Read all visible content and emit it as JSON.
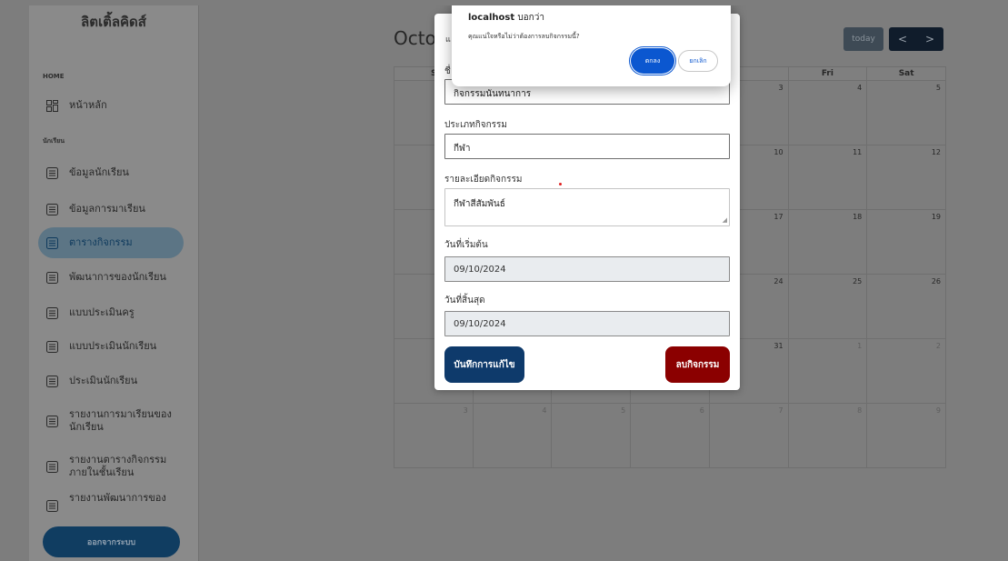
{
  "sidebar": {
    "brand": "ลิตเติ้ลคิดส์",
    "section_home": "HOME",
    "section_students": "นักเรียน",
    "home_item": "หน้าหลัก",
    "items": [
      {
        "label": "ข้อมูลนักเรียน"
      },
      {
        "label": "ข้อมูลการมาเรียน"
      },
      {
        "label": "ตารางกิจกรรม"
      },
      {
        "label": "พัฒนาการของนักเรียน"
      },
      {
        "label": "แบบประเมินครู"
      },
      {
        "label": "แบบประเมินนักเรียน"
      },
      {
        "label": "ประเมินนักเรียน"
      },
      {
        "label": "รายงานการมาเรียนของนักเรียน"
      },
      {
        "label": "รายงานตารางกิจกรรมภายในชั้นเรียน"
      },
      {
        "label": "รายงานพัฒนาการของ"
      }
    ],
    "active_index": 2,
    "logout": "ออกจากระบบ"
  },
  "calendar": {
    "title": "Octob",
    "today": "today",
    "prev": "<",
    "next": ">",
    "headers": [
      "Su",
      "",
      "",
      "",
      "Thu",
      "Fri",
      "Sat"
    ],
    "rows": [
      [
        "",
        "",
        "",
        "",
        "3",
        "4",
        "5"
      ],
      [
        "",
        "",
        "",
        "",
        "10",
        "11",
        "12"
      ],
      [
        "",
        "",
        "",
        "",
        "17",
        "18",
        "19"
      ],
      [
        "",
        "",
        "",
        "",
        "24",
        "25",
        "26"
      ],
      [
        "",
        "",
        "",
        "",
        "31",
        "1",
        "2"
      ],
      [
        "",
        "3",
        "4",
        "5",
        "6",
        "7",
        "8",
        "9"
      ]
    ]
  },
  "modal": {
    "top_fragment": "แ",
    "name_label_fragment": "ชื่",
    "name_value": "กิจกรรมนันทนาการ",
    "type_label": "ประเภทกิจกรรม",
    "type_value": "กีฬา",
    "detail_label": "รายละเอียดกิจกรรม",
    "detail_value": "กีฬาสีสัมพันธ์",
    "start_label": "วันที่เริ่มต้น",
    "start_value": "09/10/2024",
    "end_label": "วันที่สิ้นสุด",
    "end_value": "09/10/2024",
    "save": "บันทึกการแก้ไข",
    "delete": "ลบกิจกรรม"
  },
  "dialog": {
    "host": "localhost",
    "says": "บอกว่า",
    "message": "คุณแน่ใจหรือไม่ว่าต้องการลบกิจกรรมนี้?",
    "ok": "ตกลง",
    "cancel": "ยกเลิก"
  }
}
